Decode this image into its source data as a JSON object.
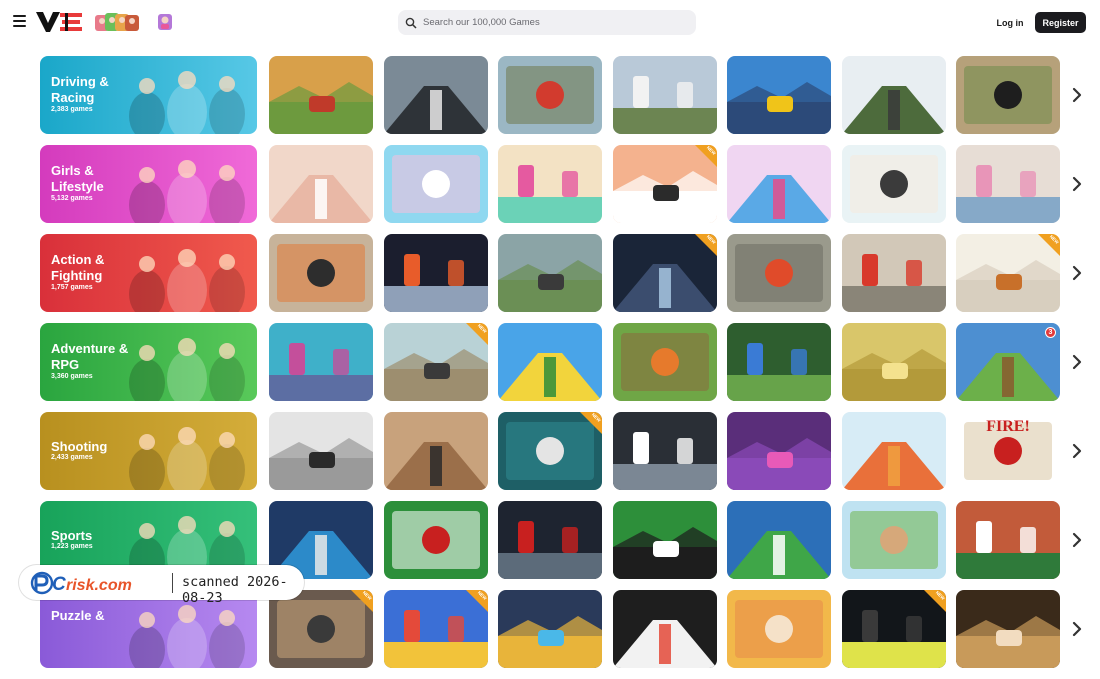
{
  "header": {
    "search_placeholder": "Search our 100,000 Games",
    "login_label": "Log in",
    "register_label": "Register",
    "icons": [
      "hamburger-menu-icon",
      "logo-icon",
      "search-icon",
      "chevron-right-icon"
    ]
  },
  "rows": [
    {
      "title": "Driving & Racing",
      "count": "2,383 games",
      "color_from": "#1aa7c9",
      "color_to": "#57c8e6",
      "tiles": [
        {
          "a": "#d8a04a",
          "b": "#6d9a3e",
          "c": "#c03a2a",
          "badge": ""
        },
        {
          "a": "#7b8a96",
          "b": "#2e3338",
          "c": "#e9e9e9",
          "badge": ""
        },
        {
          "a": "#9bb7c4",
          "b": "#6f7a4f",
          "c": "#d23b2e",
          "badge": ""
        },
        {
          "a": "#b9c9d8",
          "b": "#6c8552",
          "c": "#f2f2f2",
          "badge": ""
        },
        {
          "a": "#3b86cf",
          "b": "#2c4a79",
          "c": "#f0c419",
          "badge": ""
        },
        {
          "a": "#e8eef2",
          "b": "#4d6b3c",
          "c": "#3a3a3a",
          "badge": ""
        },
        {
          "a": "#b6a17a",
          "b": "#6f8c4a",
          "c": "#1e1e1e",
          "badge": ""
        }
      ]
    },
    {
      "title": "Girls & Lifestyle",
      "count": "5,132 games",
      "color_from": "#d43bbd",
      "color_to": "#f06ad8",
      "tiles": [
        {
          "a": "#f1d7c9",
          "b": "#e9b8a6",
          "c": "#ffffff",
          "badge": ""
        },
        {
          "a": "#8fd8f0",
          "b": "#f7c0dc",
          "c": "#ffffff",
          "badge": ""
        },
        {
          "a": "#f3e2c4",
          "b": "#6bd2b7",
          "c": "#e55aa0",
          "badge": ""
        },
        {
          "a": "#f4b28e",
          "b": "#ffffff",
          "c": "#2b2b2b",
          "badge": "NEW"
        },
        {
          "a": "#f0d6f2",
          "b": "#5aa9e6",
          "c": "#e64e8a",
          "badge": ""
        },
        {
          "a": "#e9f3f5",
          "b": "#f5e9dd",
          "c": "#3b3b3b",
          "badge": ""
        },
        {
          "a": "#e7ddd5",
          "b": "#86a9c8",
          "c": "#e895b8",
          "badge": ""
        }
      ]
    },
    {
      "title": "Action & Fighting",
      "count": "1,757 games",
      "color_from": "#d9303a",
      "color_to": "#f05a4d",
      "tiles": [
        {
          "a": "#c7b39a",
          "b": "#e07a3a",
          "c": "#2d2d2d",
          "badge": ""
        },
        {
          "a": "#1b1e2e",
          "b": "#8fa0b8",
          "c": "#e85c2a",
          "badge": ""
        },
        {
          "a": "#8ba4a6",
          "b": "#6b8f55",
          "c": "#3a3a3a",
          "badge": ""
        },
        {
          "a": "#1a2538",
          "b": "#3b4d6e",
          "c": "#a7c6e0",
          "badge": "NEW"
        },
        {
          "a": "#9a9a8c",
          "b": "#6e6e62",
          "c": "#e04b2a",
          "badge": ""
        },
        {
          "a": "#d2c8b8",
          "b": "#8a8578",
          "c": "#d8392b",
          "badge": ""
        },
        {
          "a": "#f3efe4",
          "b": "#d8cfbf",
          "c": "#c8702a",
          "badge": "NEW"
        }
      ]
    },
    {
      "title": "Adventure & RPG",
      "count": "3,360 games",
      "color_from": "#2aa53f",
      "color_to": "#59c95a",
      "tiles": [
        {
          "a": "#3fb0c9",
          "b": "#5c6ea3",
          "c": "#c44f9b",
          "badge": ""
        },
        {
          "a": "#b9d2d6",
          "b": "#9d8e6f",
          "c": "#3a3a3a",
          "badge": "NEW"
        },
        {
          "a": "#49a4e8",
          "b": "#f2d43c",
          "c": "#2f8c3a",
          "badge": ""
        },
        {
          "a": "#6fa646",
          "b": "#8a6a3e",
          "c": "#e67a2c",
          "badge": ""
        },
        {
          "a": "#2e5e2f",
          "b": "#67a34a",
          "c": "#3a7bd5",
          "badge": ""
        },
        {
          "a": "#d9c66a",
          "b": "#b39a3a",
          "c": "#f4e28e",
          "badge": ""
        },
        {
          "a": "#4d8fd1",
          "b": "#6cb04a",
          "c": "#8a5a2e",
          "badge": "3"
        }
      ]
    },
    {
      "title": "Shooting",
      "count": "2,433 games",
      "color_from": "#b8901f",
      "color_to": "#d4ad3a",
      "tiles": [
        {
          "a": "#e4e4e4",
          "b": "#9a9a9a",
          "c": "#2a2a2a",
          "badge": ""
        },
        {
          "a": "#c8a27c",
          "b": "#9b6f4a",
          "c": "#2a2a2a",
          "badge": ""
        },
        {
          "a": "#1e5f66",
          "b": "#2f8b91",
          "c": "#e4e4e4",
          "badge": "NEW"
        },
        {
          "a": "#2a2f36",
          "b": "#7b8794",
          "c": "#ffffff",
          "badge": ""
        },
        {
          "a": "#5a2e7a",
          "b": "#8a4ab8",
          "c": "#e85ab8",
          "badge": ""
        },
        {
          "a": "#d7ecf6",
          "b": "#e9703a",
          "c": "#f0a040",
          "badge": ""
        },
        {
          "a": "#ffffff",
          "b": "#d8c6a4",
          "c": "#c8201f",
          "badge": "FIRE!"
        }
      ]
    },
    {
      "title": "Sports",
      "count": "1,223 games",
      "color_from": "#18a35a",
      "color_to": "#35c07a",
      "tiles": [
        {
          "a": "#1f3a66",
          "b": "#2c8ac9",
          "c": "#e8e8e8",
          "badge": ""
        },
        {
          "a": "#2c8f3a",
          "b": "#ffffff",
          "c": "#c8201f",
          "badge": ""
        },
        {
          "a": "#1e2430",
          "b": "#5c6b7a",
          "c": "#c8201f",
          "badge": ""
        },
        {
          "a": "#2d8f3a",
          "b": "#1d1d1d",
          "c": "#ffffff",
          "badge": ""
        },
        {
          "a": "#2c6fb8",
          "b": "#3fa648",
          "c": "#ffffff",
          "badge": ""
        },
        {
          "a": "#bfe2f1",
          "b": "#6fb54a",
          "c": "#d6a87a",
          "badge": ""
        },
        {
          "a": "#c25b3a",
          "b": "#2f7a3a",
          "c": "#ffffff",
          "badge": ""
        }
      ]
    },
    {
      "title": "Puzzle &",
      "count": "",
      "color_from": "#8a5ad8",
      "color_to": "#b689f0",
      "tiles": [
        {
          "a": "#6a5a4e",
          "b": "#c9a57a",
          "c": "#3a3a3a",
          "badge": "NEW"
        },
        {
          "a": "#3b6fd6",
          "b": "#f2c33a",
          "c": "#e44a3a",
          "badge": "NEW"
        },
        {
          "a": "#2a3a5a",
          "b": "#e8b43a",
          "c": "#4ab8e8",
          "badge": ""
        },
        {
          "a": "#1e1e1e",
          "b": "#f2f2f2",
          "c": "#e44a3a",
          "badge": ""
        },
        {
          "a": "#f2b84a",
          "b": "#e88a4a",
          "c": "#f5e1c8",
          "badge": ""
        },
        {
          "a": "#12161a",
          "b": "#dfe34a",
          "c": "#3a3a3a",
          "badge": "NEW"
        },
        {
          "a": "#3a2a1a",
          "b": "#c89a5a",
          "c": "#f2dcc0",
          "badge": ""
        }
      ]
    }
  ],
  "watermark": {
    "brand": "PCrisk.com",
    "text": "scanned 2026-08-23"
  }
}
